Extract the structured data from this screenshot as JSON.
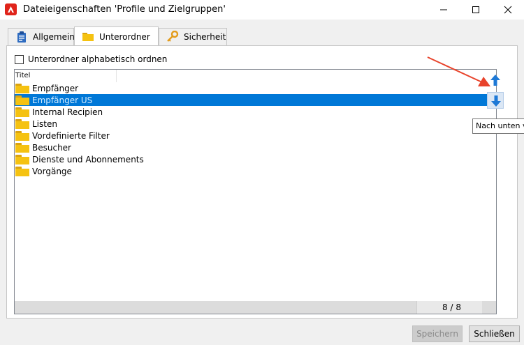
{
  "window": {
    "title": "Dateieigenschaften 'Profile und Zielgruppen'"
  },
  "tabs": [
    {
      "label": "Allgemein",
      "icon": "clipboard-icon",
      "active": false
    },
    {
      "label": "Unterordner",
      "icon": "folder-icon",
      "active": true
    },
    {
      "label": "Sicherheit",
      "icon": "key-icon",
      "active": false
    }
  ],
  "sort_option": {
    "label": "Unterordner alphabetisch ordnen",
    "checked": false
  },
  "list": {
    "header": "Titel",
    "items": [
      {
        "label": "Empfänger",
        "selected": false
      },
      {
        "label": "Empfänger US",
        "selected": true
      },
      {
        "label": "Internal Recipien",
        "selected": false
      },
      {
        "label": "Listen",
        "selected": false
      },
      {
        "label": "Vordefinierte Filter",
        "selected": false
      },
      {
        "label": "Besucher",
        "selected": false
      },
      {
        "label": "Dienste und Abonnements",
        "selected": false
      },
      {
        "label": "Vorgänge",
        "selected": false
      }
    ],
    "counter": "8 / 8"
  },
  "tooltip": "Nach unten verschieben",
  "buttons": {
    "save": "Speichern",
    "close": "Schließen"
  },
  "colors": {
    "selection": "#0078d7",
    "folder": "#f5c211",
    "arrow_blue": "#1e79d6",
    "annotation": "#e8432b",
    "logo": "#e0241b"
  }
}
